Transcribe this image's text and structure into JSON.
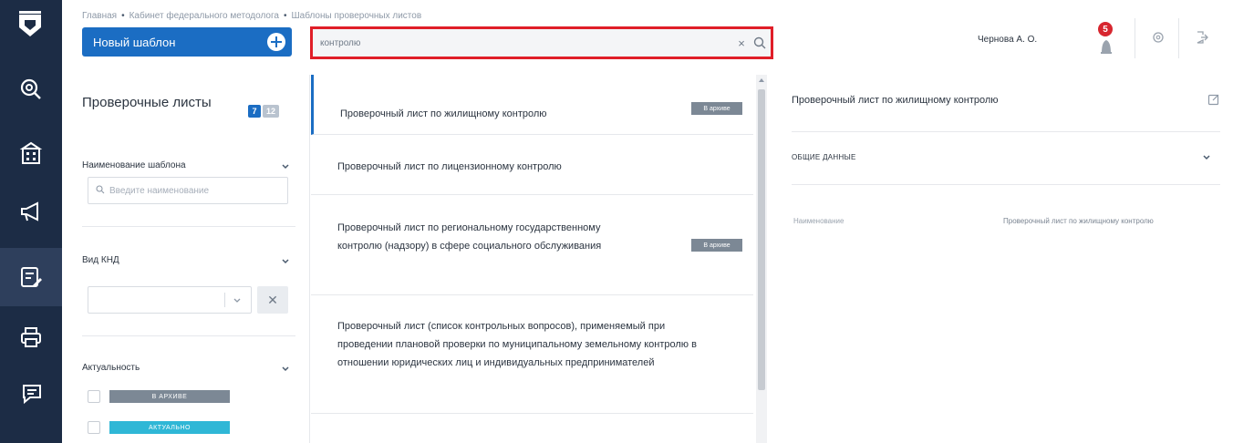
{
  "breadcrumb": [
    "Главная",
    "Кабинет федерального методолога",
    "Шаблоны проверочных листов"
  ],
  "header": {
    "new_template_label": "Новый шаблон",
    "search_value": "контролю",
    "clear_glyph": "×",
    "user_name": "Чернова А. О.",
    "notifications_count": "5"
  },
  "rail": {
    "icons": [
      "logo-shield-icon",
      "search-icon",
      "building-icon",
      "megaphone-icon",
      "checklist-edit-icon",
      "printer-icon",
      "chat-icon"
    ]
  },
  "filters": {
    "title": "Проверочные листы",
    "count_primary": "7",
    "count_secondary": "12",
    "template_name_label": "Наименование шаблона",
    "template_name_placeholder": "Введите наименование",
    "knd_type_label": "Вид КНД",
    "knd_type_value": "",
    "relevance_label": "Актуальность",
    "relevance_options": [
      {
        "label": "В АРХИВЕ",
        "color": "#7c8895"
      },
      {
        "label": "АКТУАЛЬНО",
        "color": "#2fb7d6"
      }
    ]
  },
  "list": {
    "items": [
      {
        "title": "Проверочный лист по жилищному контролю",
        "tag": "В архиве"
      },
      {
        "title": "Проверочный лист по лицензионному контролю",
        "tag": ""
      },
      {
        "title": "Проверочный лист по региональному государственному контролю (надзору) в сфере социального обслуживания",
        "tag": "В архиве"
      },
      {
        "title": "Проверочный лист (список контрольных вопросов), применяемый при проведении плановой проверки по муниципальному земельному контролю в отношении юридических лиц и индивидуальных предпринимателей",
        "tag": ""
      }
    ]
  },
  "details": {
    "title": "Проверочный лист по жилищному контролю",
    "section_label": "ОБЩИЕ ДАННЫЕ",
    "field_name_label": "Наименование",
    "field_name_value": "Проверочный лист по жилищному контролю"
  },
  "colors": {
    "rail_bg": "#1c2c45",
    "primary": "#1b6dc3",
    "search_highlight": "#e01e28",
    "badge": "#d7262f",
    "archive_tag": "#7c8895",
    "actual_tag": "#2fb7d6"
  }
}
